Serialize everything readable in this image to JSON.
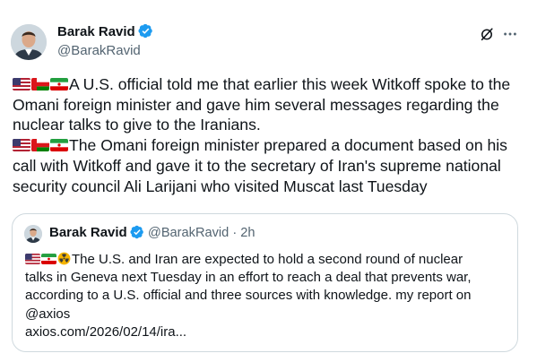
{
  "author": {
    "display_name": "Barak Ravid",
    "handle": "@BarakRavid",
    "verified": true
  },
  "header_icons": [
    "grok-icon",
    "more-icon"
  ],
  "post": {
    "lines": [
      "A U.S. official told me that earlier this week Witkoff spoke to the",
      "Omani foreign minister and gave him several messages regarding the",
      "nuclear talks to give to the Iranians.",
      "The Omani foreign minister prepared a document based on his",
      "call with Witkoff and gave it to the secretary of Iran's supreme national",
      "security council Ali Larijani who visited Muscat last Tuesday"
    ],
    "emoji_prefix": [
      "flag-us",
      "flag-oman",
      "flag-iran"
    ]
  },
  "quoted": {
    "display_name": "Barak Ravid",
    "handle": "@BarakRavid",
    "separator": "·",
    "time": "2h",
    "emoji_prefix": [
      "flag-us",
      "flag-iran",
      "radioactive"
    ],
    "lines": [
      "The U.S. and Iran are expected to hold a second round of nuclear",
      "talks in Geneva next Tuesday in an effort to reach a deal that prevents war,",
      "according to a U.S. official and three sources with knowledge. my report on",
      "@axios",
      "axios.com/2026/02/14/ira..."
    ]
  },
  "colors": {
    "text": "#0f1419",
    "secondary": "#536471",
    "verified": "#1d9bf0",
    "border": "#cfd9de"
  }
}
